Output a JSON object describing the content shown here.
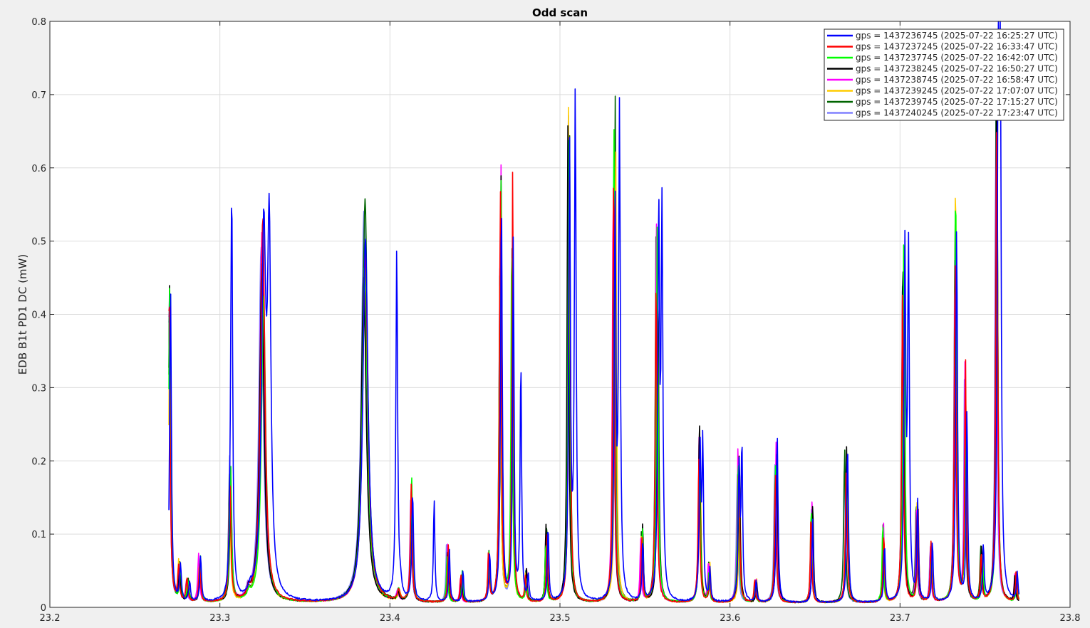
{
  "chart_data": {
    "type": "line",
    "title": "Odd scan",
    "xlabel": "",
    "ylabel": "EDB B1t PD1 DC (mW)",
    "xlim": [
      23.2,
      23.8
    ],
    "ylim": [
      0,
      0.8
    ],
    "xticks": [
      "23.2",
      "23.3",
      "23.4",
      "23.5",
      "23.6",
      "23.7",
      "23.8"
    ],
    "yticks": [
      "0",
      "0.1",
      "0.2",
      "0.3",
      "0.4",
      "0.5",
      "0.6",
      "0.7",
      "0.8"
    ],
    "grid": true,
    "legend_position": "top-right",
    "x_range_data": [
      23.27,
      23.77
    ],
    "baseline": 0.006,
    "series": [
      {
        "name": "gps = 1437236745 (2025-07-22 16:25:27 UTC)",
        "color": "#0000ff",
        "offset": 0.0008
      },
      {
        "name": "gps = 1437237245 (2025-07-22 16:33:47 UTC)",
        "color": "#ff0000",
        "offset": 0.0
      },
      {
        "name": "gps = 1437237745 (2025-07-22 16:42:07 UTC)",
        "color": "#00ff00",
        "offset": 0.0002
      },
      {
        "name": "gps = 1437238245 (2025-07-22 16:50:27 UTC)",
        "color": "#000000",
        "offset": 0.0001
      },
      {
        "name": "gps = 1437238745 (2025-07-22 16:58:47 UTC)",
        "color": "#ff00ff",
        "offset": -0.0001
      },
      {
        "name": "gps = 1437239245 (2025-07-22 17:07:07 UTC)",
        "color": "#ffcc00",
        "offset": 0.0002
      },
      {
        "name": "gps = 1437239745 (2025-07-22 17:15:27 UTC)",
        "color": "#006400",
        "offset": 0.0
      },
      {
        "name": "gps = 1437240245 (2025-07-22 17:23:47 UTC)",
        "color": "#8080ff",
        "offset": -0.0002
      }
    ],
    "peaks": [
      {
        "x": 23.27,
        "y": 0.4,
        "w": 0.0006
      },
      {
        "x": 23.276,
        "y": 0.05,
        "w": 0.0006
      },
      {
        "x": 23.281,
        "y": 0.03,
        "w": 0.0006
      },
      {
        "x": 23.288,
        "y": 0.06,
        "w": 0.0006
      },
      {
        "x": 23.306,
        "y": 0.18,
        "w": 0.0007
      },
      {
        "x": 23.317,
        "y": 0.012,
        "w": 0.001
      },
      {
        "x": 23.325,
        "y": 0.48,
        "w": 0.0015
      },
      {
        "x": 23.385,
        "y": 0.51,
        "w": 0.0018
      },
      {
        "x": 23.405,
        "y": 0.015,
        "w": 0.0008
      },
      {
        "x": 23.412,
        "y": 0.16,
        "w": 0.0006
      },
      {
        "x": 23.434,
        "y": 0.08,
        "w": 0.0005
      },
      {
        "x": 23.442,
        "y": 0.04,
        "w": 0.0005
      },
      {
        "x": 23.458,
        "y": 0.08,
        "w": 0.0005
      },
      {
        "x": 23.465,
        "y": 0.55,
        "w": 0.0006
      },
      {
        "x": 23.472,
        "y": 0.54,
        "w": 0.0005
      },
      {
        "x": 23.48,
        "y": 0.04,
        "w": 0.0005
      },
      {
        "x": 23.492,
        "y": 0.1,
        "w": 0.0005
      },
      {
        "x": 23.505,
        "y": 0.69,
        "w": 0.0006
      },
      {
        "x": 23.532,
        "y": 0.64,
        "w": 0.0006
      },
      {
        "x": 23.548,
        "y": 0.1,
        "w": 0.0005
      },
      {
        "x": 23.557,
        "y": 0.52,
        "w": 0.0006
      },
      {
        "x": 23.582,
        "y": 0.23,
        "w": 0.0006
      },
      {
        "x": 23.588,
        "y": 0.05,
        "w": 0.0005
      },
      {
        "x": 23.605,
        "y": 0.2,
        "w": 0.0006
      },
      {
        "x": 23.615,
        "y": 0.03,
        "w": 0.0005
      },
      {
        "x": 23.627,
        "y": 0.21,
        "w": 0.0006
      },
      {
        "x": 23.648,
        "y": 0.14,
        "w": 0.0005
      },
      {
        "x": 23.668,
        "y": 0.21,
        "w": 0.0006
      },
      {
        "x": 23.69,
        "y": 0.1,
        "w": 0.0005
      },
      {
        "x": 23.702,
        "y": 0.48,
        "w": 0.0006
      },
      {
        "x": 23.71,
        "y": 0.14,
        "w": 0.0005
      },
      {
        "x": 23.718,
        "y": 0.08,
        "w": 0.0005
      },
      {
        "x": 23.733,
        "y": 0.54,
        "w": 0.0006
      },
      {
        "x": 23.738,
        "y": 0.32,
        "w": 0.0005
      },
      {
        "x": 23.748,
        "y": 0.07,
        "w": 0.0005
      },
      {
        "x": 23.757,
        "y": 0.7,
        "w": 0.0006
      },
      {
        "x": 23.768,
        "y": 0.04,
        "w": 0.0005
      }
    ],
    "blue_extra_peaks": [
      {
        "x": 23.307,
        "y": 0.47,
        "w": 0.0006
      },
      {
        "x": 23.329,
        "y": 0.47,
        "w": 0.0012
      },
      {
        "x": 23.404,
        "y": 0.48,
        "w": 0.0006
      },
      {
        "x": 23.426,
        "y": 0.14,
        "w": 0.0005
      },
      {
        "x": 23.477,
        "y": 0.33,
        "w": 0.0005
      },
      {
        "x": 23.509,
        "y": 0.69,
        "w": 0.0006
      },
      {
        "x": 23.535,
        "y": 0.66,
        "w": 0.0006
      },
      {
        "x": 23.56,
        "y": 0.52,
        "w": 0.0006
      },
      {
        "x": 23.584,
        "y": 0.21,
        "w": 0.0005
      },
      {
        "x": 23.607,
        "y": 0.21,
        "w": 0.0005
      },
      {
        "x": 23.705,
        "y": 0.47,
        "w": 0.0006
      },
      {
        "x": 23.759,
        "y": 0.66,
        "w": 0.0006
      }
    ]
  }
}
